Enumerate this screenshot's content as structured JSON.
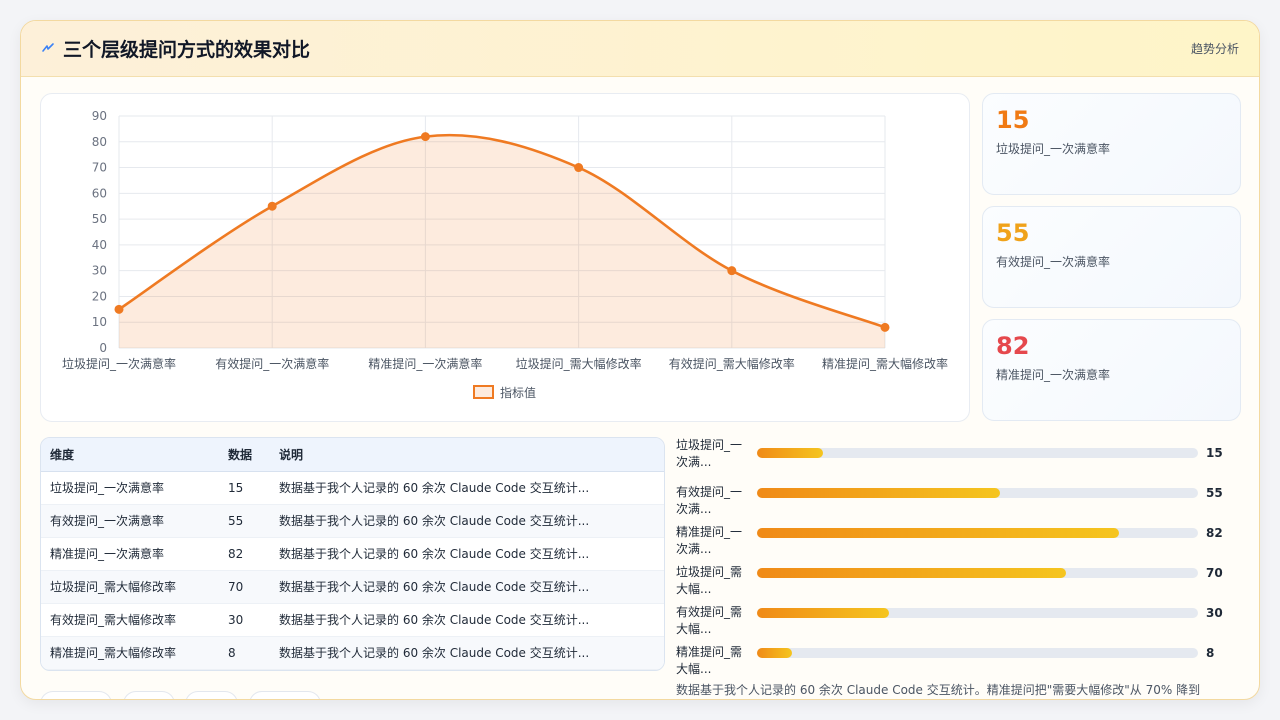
{
  "header": {
    "title": "三个层级提问方式的效果对比",
    "subtitle": "趋势分析",
    "icon": "lightning-icon"
  },
  "colors": {
    "accent": "#ef7a22",
    "stat_orange": "#f07a14",
    "stat_amber": "#f0a21a",
    "stat_red": "#e5484d"
  },
  "chart_data": {
    "type": "area",
    "categories": [
      "垃圾提问_一次满意率",
      "有效提问_一次满意率",
      "精准提问_一次满意率",
      "垃圾提问_需大幅修改率",
      "有效提问_需大幅修改率",
      "精准提问_需大幅修改率"
    ],
    "series": [
      {
        "name": "指标值",
        "values": [
          15,
          55,
          82,
          70,
          30,
          8
        ]
      }
    ],
    "ylim": [
      0,
      90
    ],
    "yticks": [
      0,
      10,
      20,
      30,
      40,
      50,
      60,
      70,
      80,
      90
    ],
    "grid": true,
    "legend": "bottom"
  },
  "stats": [
    {
      "value": "15",
      "label": "垃圾提问_一次满意率"
    },
    {
      "value": "55",
      "label": "有效提问_一次满意率"
    },
    {
      "value": "82",
      "label": "精准提问_一次满意率"
    }
  ],
  "table": {
    "headers": [
      "维度",
      "数据",
      "说明"
    ],
    "rows": [
      [
        "垃圾提问_一次满意率",
        "15",
        "数据基于我个人记录的 60 余次 Claude Code 交互统计..."
      ],
      [
        "有效提问_一次满意率",
        "55",
        "数据基于我个人记录的 60 余次 Claude Code 交互统计..."
      ],
      [
        "精准提问_一次满意率",
        "82",
        "数据基于我个人记录的 60 余次 Claude Code 交互统计..."
      ],
      [
        "垃圾提问_需大幅修改率",
        "70",
        "数据基于我个人记录的 60 余次 Claude Code 交互统计..."
      ],
      [
        "有效提问_需大幅修改率",
        "30",
        "数据基于我个人记录的 60 余次 Claude Code 交互统计..."
      ],
      [
        "精准提问_需大幅修改率",
        "8",
        "数据基于我个人记录的 60 余次 Claude Code 交互统计..."
      ]
    ]
  },
  "bars": [
    {
      "line1": "垃圾提问_一",
      "line2": "次满...",
      "value": 15,
      "value_label": "15"
    },
    {
      "line1": "有效提问_一",
      "line2": "次满...",
      "value": 55,
      "value_label": "55"
    },
    {
      "line1": "精准提问_一",
      "line2": "次满...",
      "value": 82,
      "value_label": "82"
    },
    {
      "line1": "垃圾提问_需",
      "line2": "大幅...",
      "value": 70,
      "value_label": "70"
    },
    {
      "line1": "有效提问_需",
      "line2": "大幅...",
      "value": 30,
      "value_label": "30"
    },
    {
      "line1": "精准提问_需",
      "line2": "大幅...",
      "value": 8,
      "value_label": "8"
    }
  ],
  "bars_max": 100,
  "footnote": "数据基于我个人记录的 60 余次 Claude Code 交互统计。精准提问把\"需要大幅修改\"从 70% 降到"
}
